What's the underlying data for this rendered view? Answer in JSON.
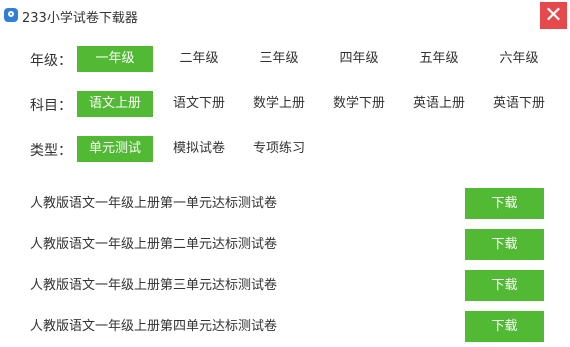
{
  "window": {
    "title": "233小学试卷下载器",
    "close_label": "✕"
  },
  "filters": {
    "grade": {
      "label": "年级：",
      "options": [
        "一年级",
        "二年级",
        "三年级",
        "四年级",
        "五年级",
        "六年级"
      ],
      "selected": "一年级"
    },
    "subject": {
      "label": "科目：",
      "options": [
        "语文上册",
        "语文下册",
        "数学上册",
        "数学下册",
        "英语上册",
        "英语下册"
      ],
      "selected": "语文上册"
    },
    "type": {
      "label": "类型：",
      "options": [
        "单元测试",
        "模拟试卷",
        "专项练习"
      ],
      "selected": "单元测试"
    }
  },
  "papers": [
    {
      "title": "人教版语文一年级上册第一单元达标测试卷",
      "button": "下载"
    },
    {
      "title": "人教版语文一年级上册第二单元达标测试卷",
      "button": "下载"
    },
    {
      "title": "人教版语文一年级上册第三单元达标测试卷",
      "button": "下载"
    },
    {
      "title": "人教版语文一年级上册第四单元达标测试卷",
      "button": "下载"
    }
  ],
  "colors": {
    "accent": "#52b935",
    "close": "#e5494c"
  }
}
